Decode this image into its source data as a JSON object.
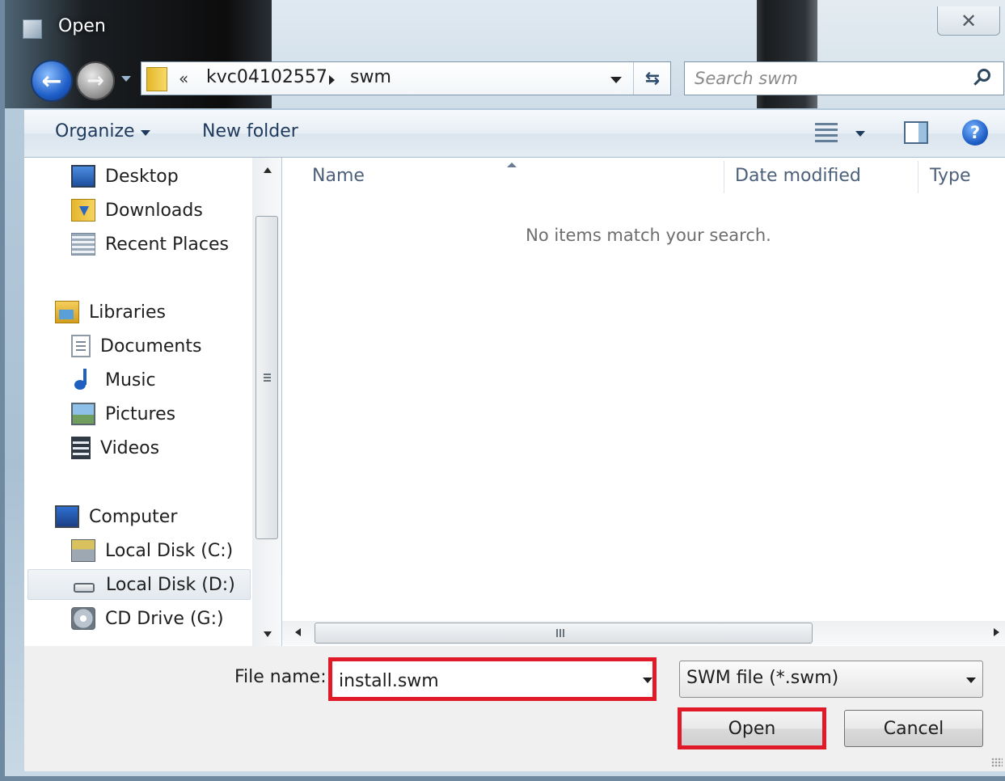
{
  "window": {
    "title": "Open",
    "close_glyph": "✕"
  },
  "navigation": {
    "back_icon": "back-arrow-icon",
    "forward_icon": "forward-arrow-icon",
    "address": {
      "chevron": "«",
      "segments": [
        "kvc04102557",
        "swm"
      ]
    },
    "search_placeholder": "Search swm"
  },
  "toolbar": {
    "organize_label": "Organize",
    "new_folder_label": "New folder",
    "help_glyph": "?"
  },
  "nav_pane": {
    "favorites": [
      {
        "label": "Desktop",
        "icon": "desktop-icon"
      },
      {
        "label": "Downloads",
        "icon": "downloads-icon"
      },
      {
        "label": "Recent Places",
        "icon": "recent-places-icon"
      }
    ],
    "libraries": {
      "label": "Libraries",
      "icon": "libraries-icon",
      "items": [
        {
          "label": "Documents",
          "icon": "documents-icon"
        },
        {
          "label": "Music",
          "icon": "music-icon"
        },
        {
          "label": "Pictures",
          "icon": "pictures-icon"
        },
        {
          "label": "Videos",
          "icon": "videos-icon"
        }
      ]
    },
    "computer": {
      "label": "Computer",
      "icon": "computer-icon",
      "items": [
        {
          "label": "Local Disk (C:)",
          "icon": "local-disk-c-icon"
        },
        {
          "label": "Local Disk (D:)",
          "icon": "local-disk-d-icon",
          "selected": true
        },
        {
          "label": "CD Drive (G:)",
          "icon": "cd-drive-icon"
        }
      ]
    }
  },
  "file_list": {
    "columns": [
      "Name",
      "Date modified",
      "Type"
    ],
    "empty_message": "No items match your search.",
    "h_scroll_grip": "III"
  },
  "bottom": {
    "file_name_label": "File name:",
    "file_name_value": "install.swm",
    "file_type": "SWM file (*.swm)",
    "open_label": "Open",
    "cancel_label": "Cancel"
  },
  "colors": {
    "highlight_box": "#e01a28",
    "toolbar_text": "#1e395b"
  }
}
